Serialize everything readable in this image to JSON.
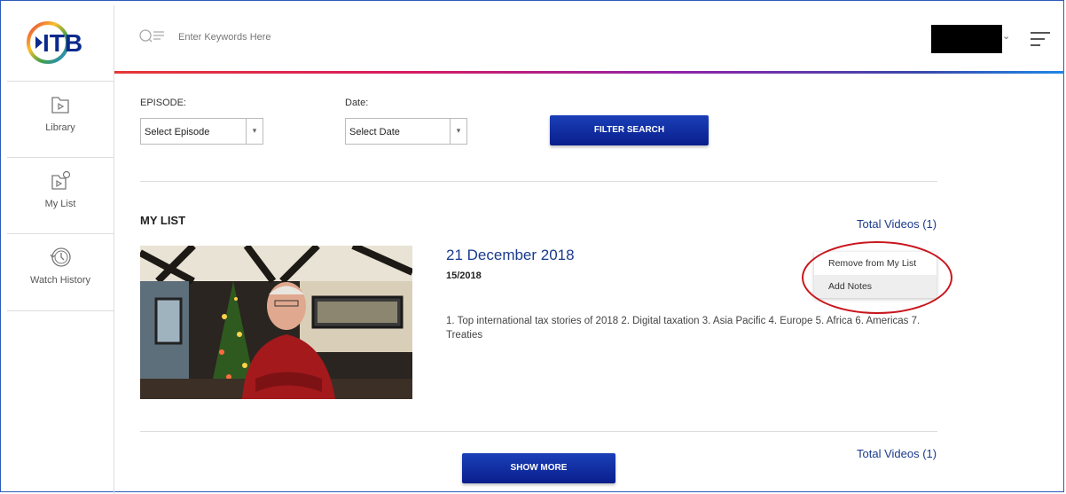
{
  "logo": {
    "text": "ITB"
  },
  "sidebar": {
    "items": [
      {
        "label": "Library",
        "icon": "library-icon"
      },
      {
        "label": "My List",
        "icon": "my-list-icon"
      },
      {
        "label": "Watch History",
        "icon": "history-icon"
      }
    ]
  },
  "header": {
    "search_placeholder": "Enter Keywords Here"
  },
  "filters": {
    "episode_label": "EPISODE:",
    "episode_value": "Select Episode",
    "date_label": "Date:",
    "date_value": "Select Date",
    "filter_button": "FILTER SEARCH"
  },
  "my_list": {
    "title": "MY LIST",
    "total_videos": "Total Videos (1)",
    "video": {
      "title": "21 December 2018",
      "episode": "15/2018",
      "description": "1. Top international tax stories of 2018 2. Digital taxation 3. Asia Pacific 4. Europe 5. Africa 6. Americas 7. Treaties"
    },
    "context_menu": [
      "Remove from My List",
      "Add Notes"
    ],
    "bottom_total": "Total Videos (1)",
    "show_more": "SHOW MORE"
  },
  "colors": {
    "brand_blue": "#0a1e8c",
    "link_blue": "#1a3a8c",
    "highlight_red": "#c8161d"
  }
}
